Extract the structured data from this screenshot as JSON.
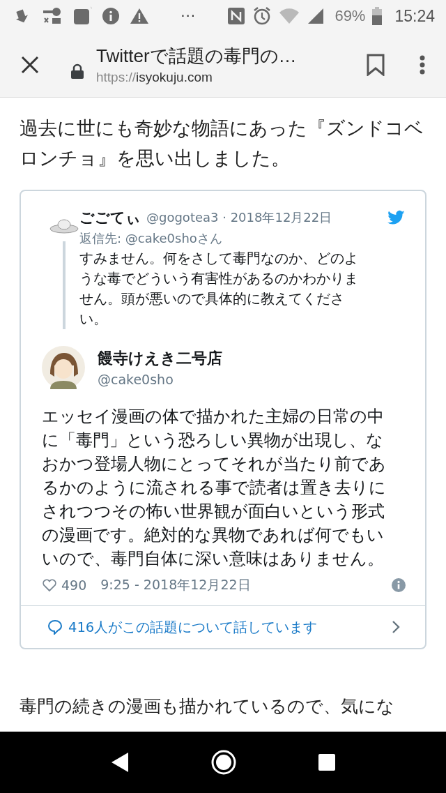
{
  "status_bar": {
    "battery": "69%",
    "time": "15:24",
    "more": "···"
  },
  "toolbar": {
    "title": "Twitterで話題の毒門の…",
    "url_scheme": "https://",
    "url_host": "isyokuju.com"
  },
  "article": {
    "paragraphs": [
      "過去に世にも奇妙な物語にあった『ズンドコベロンチョ』を思い出しました。",
      "毒門の続きの漫画も描かれているので、気にな"
    ]
  },
  "embed": {
    "reply": {
      "name": "ごごてぃ",
      "meta": "@gogotea3 · 2018年12月22日",
      "reply_to": "返信先: @cake0shoさん",
      "text": "すみません。何をさして毒門なのか、どのような毒でどういう有害性があるのかわかりません。頭が悪いので具体的に教えてください。"
    },
    "tweet": {
      "name": "饅寺けえき二号店",
      "handle": "@cake0sho",
      "text": "エッセイ漫画の体で描かれた主婦の日常の中に「毒門」という恐ろしい異物が出現し、なおかつ登場人物にとってそれが当たり前であるかのように流される事で読者は置き去りにされつつその怖い世界観が面白いという形式の漫画です。絶対的な異物であれば何でもいいので、毒門自体に深い意味はありません。",
      "likes": "490",
      "timestamp": "9:25 - 2018年12月22日"
    },
    "conversation": "416人がこの話題について話しています"
  }
}
